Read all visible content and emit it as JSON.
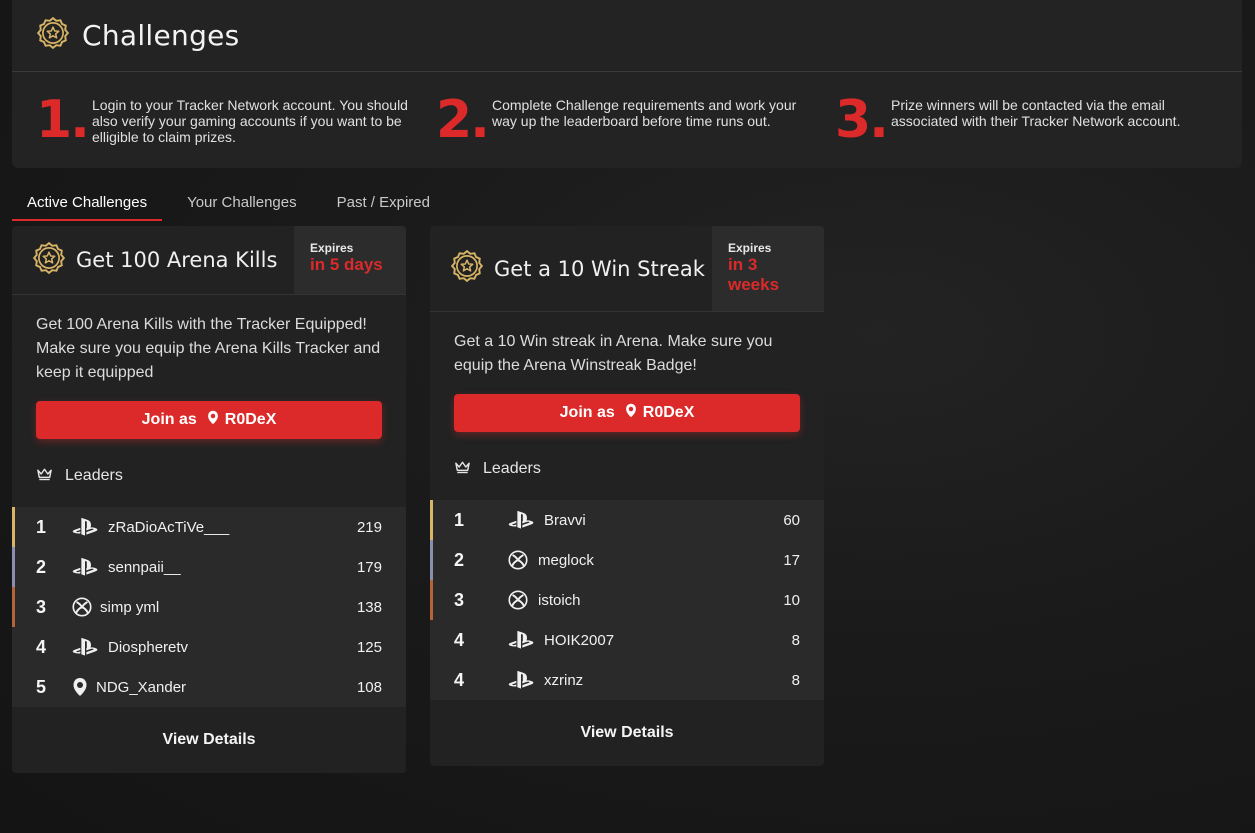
{
  "page": {
    "title": "Challenges"
  },
  "steps": [
    {
      "number": "1.",
      "text": "Login to your Tracker Network account. You should also verify your gaming accounts if you want to be elligible to claim prizes."
    },
    {
      "number": "2.",
      "text": "Complete Challenge requirements and work your way up the leaderboard before time runs out."
    },
    {
      "number": "3.",
      "text": "Prize winners will be contacted via the email associated with their Tracker Network account."
    }
  ],
  "tabs": [
    {
      "label": "Active Challenges",
      "active": true
    },
    {
      "label": "Your Challenges",
      "active": false
    },
    {
      "label": "Past / Expired",
      "active": false
    }
  ],
  "colors": {
    "accent": "#dc2a2a",
    "gold": "#d8b466",
    "silver": "#8a8fb0",
    "bronze": "#b5643a"
  },
  "challenges": [
    {
      "title": "Get 100 Arena Kills",
      "expires_label": "Expires",
      "expires_value": "in 5 days",
      "description": "Get 100 Arena Kills with the Tracker Equipped! Make sure you equip the Arena Kills Tracker and keep it equipped",
      "join_prefix": "Join as",
      "join_user": "R0DeX",
      "leaders_label": "Leaders",
      "view_details": "View Details",
      "leaders": [
        {
          "rank": "1",
          "platform": "playstation",
          "name": "zRaDioAcTiVe___",
          "score": "219"
        },
        {
          "rank": "2",
          "platform": "playstation",
          "name": "sennpaii__",
          "score": "179"
        },
        {
          "rank": "3",
          "platform": "xbox",
          "name": "simp yml",
          "score": "138"
        },
        {
          "rank": "4",
          "platform": "playstation",
          "name": "Diospheretv",
          "score": "125"
        },
        {
          "rank": "5",
          "platform": "origin",
          "name": "NDG_Xander",
          "score": "108"
        }
      ]
    },
    {
      "title": "Get a 10 Win Streak",
      "expires_label": "Expires",
      "expires_value": "in 3 weeks",
      "description": "Get a 10 Win streak in Arena. Make sure you equip the Arena Winstreak Badge!",
      "join_prefix": "Join as",
      "join_user": "R0DeX",
      "leaders_label": "Leaders",
      "view_details": "View Details",
      "leaders": [
        {
          "rank": "1",
          "platform": "playstation",
          "name": "Bravvi",
          "score": "60"
        },
        {
          "rank": "2",
          "platform": "xbox",
          "name": "meglock",
          "score": "17"
        },
        {
          "rank": "3",
          "platform": "xbox",
          "name": "istoich",
          "score": "10"
        },
        {
          "rank": "4",
          "platform": "playstation",
          "name": "HOIK2007",
          "score": "8"
        },
        {
          "rank": "4",
          "platform": "playstation",
          "name": "xzrinz",
          "score": "8"
        }
      ]
    }
  ]
}
